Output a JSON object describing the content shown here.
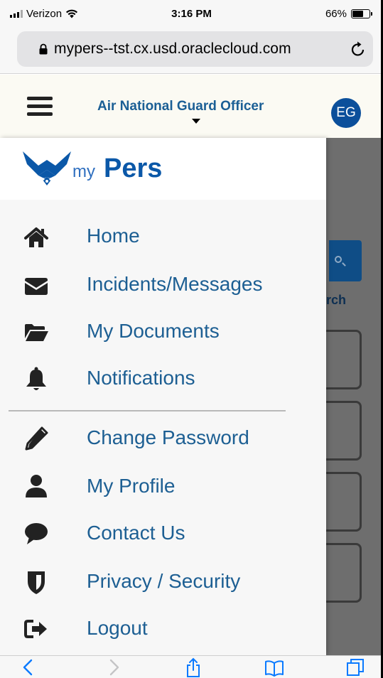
{
  "status_bar": {
    "carrier": "Verizon",
    "time": "3:16 PM",
    "battery_percent_label": "66%",
    "battery_level": 0.66
  },
  "browser": {
    "url": "mypers--tst.cx.usd.oraclecloud.com"
  },
  "header": {
    "role": "Air National Guard Officer",
    "user_initials": "EG"
  },
  "brand": {
    "prefix": "my",
    "name": "Pers"
  },
  "menu": {
    "items": [
      {
        "label": "Home",
        "icon": "home-icon"
      },
      {
        "label": "Incidents/Messages",
        "icon": "envelope-icon"
      },
      {
        "label": "My Documents",
        "icon": "folder-open-icon"
      },
      {
        "label": "Notifications",
        "icon": "bell-icon"
      },
      {
        "label": "Change Password",
        "icon": "pencil-icon"
      },
      {
        "label": "My Profile",
        "icon": "user-icon"
      },
      {
        "label": "Contact Us",
        "icon": "speech-bubble-icon"
      },
      {
        "label": "Privacy / Security",
        "icon": "shield-icon"
      },
      {
        "label": "Logout",
        "icon": "sign-out-icon"
      }
    ]
  },
  "background_page": {
    "search_label_fragment": "rch"
  },
  "colors": {
    "link_blue": "#1d5f93",
    "role_blue": "#1b5f95",
    "avatar_blue": "#0b4f9b",
    "brand_blue": "#0b58a8",
    "toolbar_blue": "#0a7aff"
  }
}
